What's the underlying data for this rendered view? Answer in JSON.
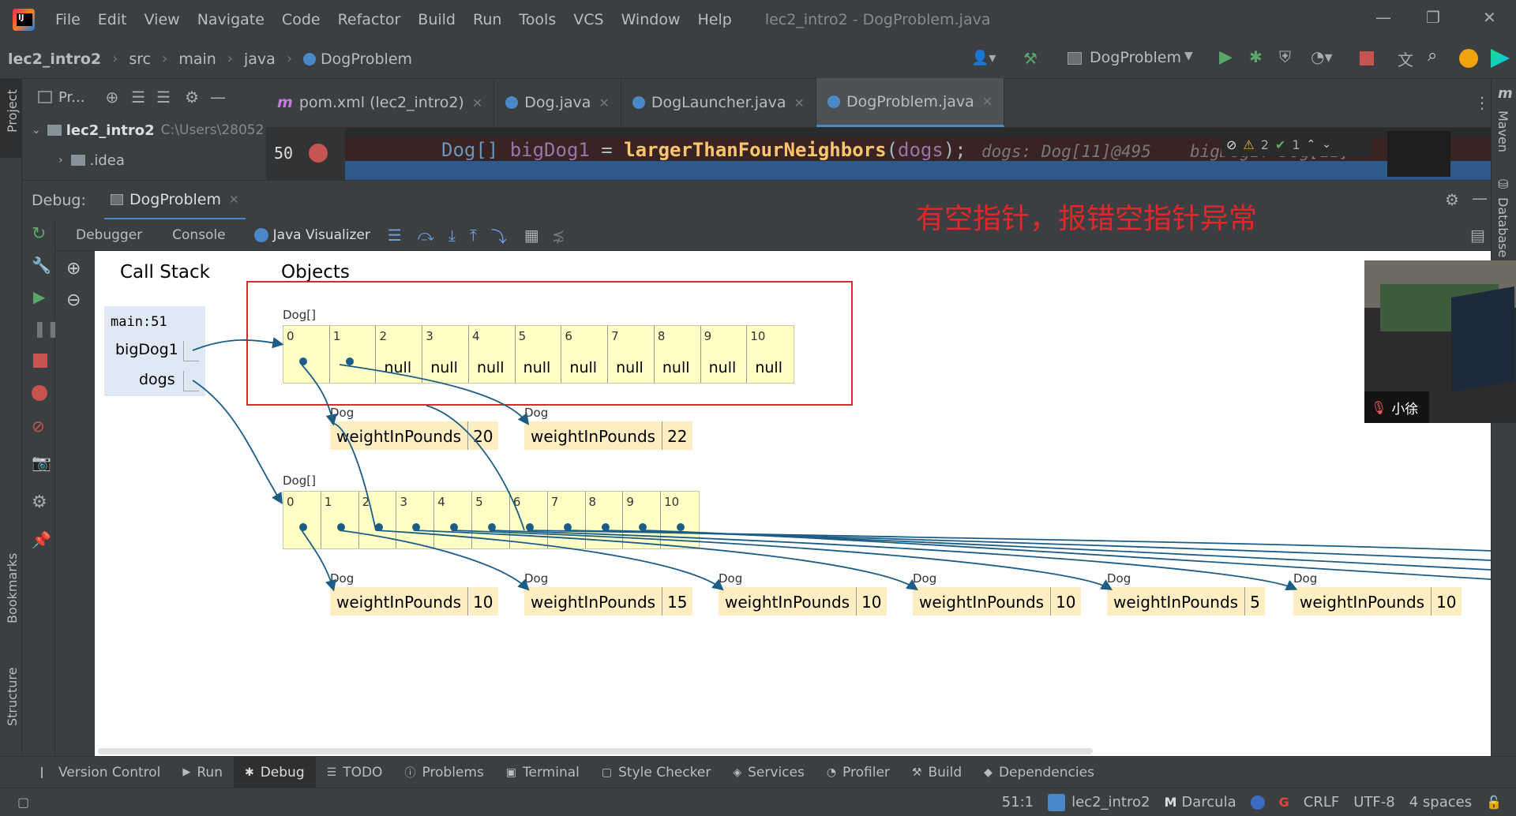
{
  "menu": {
    "items": [
      "File",
      "Edit",
      "View",
      "Navigate",
      "Code",
      "Refactor",
      "Build",
      "Run",
      "Tools",
      "VCS",
      "Window",
      "Help"
    ],
    "window_title": "lec2_intro2 - DogProblem.java"
  },
  "breadcrumb": {
    "items": [
      "lec2_intro2",
      "src",
      "main",
      "java",
      "DogProblem"
    ],
    "run_config": "DogProblem"
  },
  "project_panel": {
    "title": "Pr...",
    "root_name": "lec2_intro2",
    "root_path": "C:\\Users\\28052",
    "child": ".idea"
  },
  "editor_tabs": [
    {
      "label": "pom.xml (lec2_intro2)",
      "icon": "maven-icon",
      "active": false
    },
    {
      "label": "Dog.java",
      "icon": "class-icon",
      "active": false
    },
    {
      "label": "DogLauncher.java",
      "icon": "class-icon",
      "active": false
    },
    {
      "label": "DogProblem.java",
      "icon": "class-icon",
      "active": true
    }
  ],
  "editor": {
    "line_number": "50",
    "code_type": "Dog[]",
    "code_var": "bigDog1",
    "code_eq": " = ",
    "code_method": "largerThanFourNeighbors",
    "code_paren_open": "(",
    "code_arg": "dogs",
    "code_paren_close": ");",
    "inline_hint": "dogs: Dog[11]@495",
    "inline_hint2": "bigDog1: Dog[11]",
    "warnings": "2",
    "ok_count": "1"
  },
  "debug": {
    "label": "Debug:",
    "session": "DogProblem",
    "tabs": [
      "Debugger",
      "Console",
      "Java Visualizer"
    ]
  },
  "annotation": "有空指针，报错空指针异常",
  "visualizer": {
    "call_stack_title": "Call Stack",
    "objects_title": "Objects",
    "frame": "main:51",
    "vars": [
      "bigDog1",
      "dogs"
    ],
    "array_type": "Dog[]",
    "dog_type": "Dog",
    "field_name": "weightInPounds",
    "array1": {
      "indices": [
        "0",
        "1",
        "2",
        "3",
        "4",
        "5",
        "6",
        "7",
        "8",
        "9",
        "10"
      ],
      "values": [
        "",
        "",
        "null",
        "null",
        "null",
        "null",
        "null",
        "null",
        "null",
        "null",
        "null"
      ]
    },
    "array1_dogs": [
      "20",
      "22"
    ],
    "array2": {
      "indices": [
        "0",
        "1",
        "2",
        "3",
        "4",
        "5",
        "6",
        "7",
        "8",
        "9",
        "10"
      ]
    },
    "array2_dogs": [
      "10",
      "15",
      "10",
      "10",
      "5",
      "10"
    ]
  },
  "webcam": {
    "name": "小徐"
  },
  "bottom_tools": [
    {
      "label": "Version Control",
      "active": false
    },
    {
      "label": "Run",
      "active": false
    },
    {
      "label": "Debug",
      "active": true
    },
    {
      "label": "TODO",
      "active": false
    },
    {
      "label": "Problems",
      "active": false
    },
    {
      "label": "Terminal",
      "active": false
    },
    {
      "label": "Style Checker",
      "active": false
    },
    {
      "label": "Services",
      "active": false
    },
    {
      "label": "Profiler",
      "active": false
    },
    {
      "label": "Build",
      "active": false
    },
    {
      "label": "Dependencies",
      "active": false
    }
  ],
  "status": {
    "position": "51:1",
    "project": "lec2_intro2",
    "theme": "Darcula",
    "line_sep": "CRLF",
    "encoding": "UTF-8",
    "indent": "4 spaces"
  },
  "side_labels": {
    "project": "Project",
    "bookmarks": "Bookmarks",
    "structure": "Structure",
    "maven": "Maven",
    "database": "Database"
  }
}
